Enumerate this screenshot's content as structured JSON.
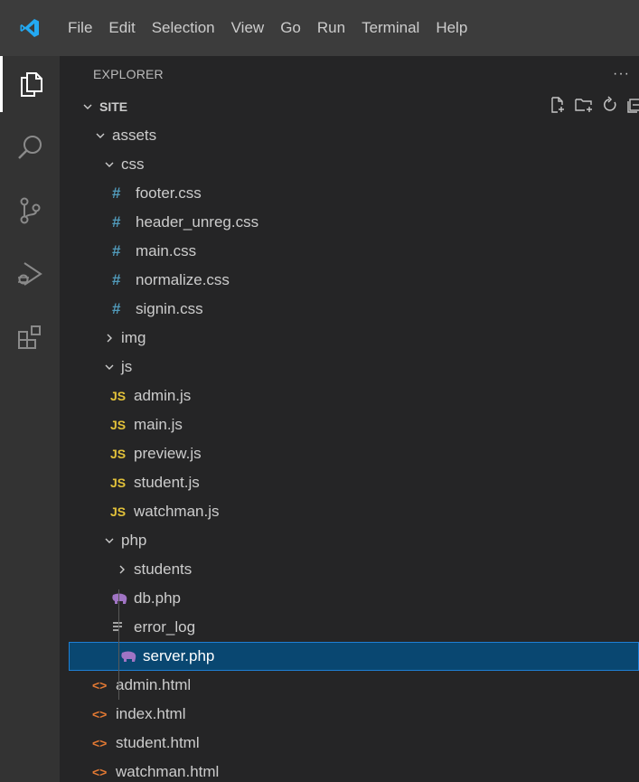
{
  "menu": [
    "File",
    "Edit",
    "Selection",
    "View",
    "Go",
    "Run",
    "Terminal",
    "Help"
  ],
  "explorer": {
    "title": "EXPLORER",
    "more": "···",
    "root": "SITE"
  },
  "tree": [
    {
      "label": "assets",
      "type": "folder",
      "open": true,
      "depth": 1
    },
    {
      "label": "css",
      "type": "folder",
      "open": true,
      "depth": 2
    },
    {
      "label": "footer.css",
      "type": "css",
      "depth": 3
    },
    {
      "label": "header_unreg.css",
      "type": "css",
      "depth": 3
    },
    {
      "label": "main.css",
      "type": "css",
      "depth": 3
    },
    {
      "label": "normalize.css",
      "type": "css",
      "depth": 3
    },
    {
      "label": "signin.css",
      "type": "css",
      "depth": 3
    },
    {
      "label": "img",
      "type": "folder",
      "open": false,
      "depth": 2
    },
    {
      "label": "js",
      "type": "folder",
      "open": true,
      "depth": 2
    },
    {
      "label": "admin.js",
      "type": "js",
      "depth": 3
    },
    {
      "label": "main.js",
      "type": "js",
      "depth": 3
    },
    {
      "label": "preview.js",
      "type": "js",
      "depth": 3
    },
    {
      "label": "student.js",
      "type": "js",
      "depth": 3
    },
    {
      "label": "watchman.js",
      "type": "js",
      "depth": 3
    },
    {
      "label": "php",
      "type": "folder",
      "open": true,
      "depth": 2
    },
    {
      "label": "students",
      "type": "folder",
      "open": false,
      "depth": 3
    },
    {
      "label": "db.php",
      "type": "php",
      "depth": 3
    },
    {
      "label": "error_log",
      "type": "log",
      "depth": 3
    },
    {
      "label": "server.php",
      "type": "php",
      "depth": 3,
      "selected": true
    },
    {
      "label": "admin.html",
      "type": "html",
      "depth": 1
    },
    {
      "label": "index.html",
      "type": "html",
      "depth": 1
    },
    {
      "label": "student.html",
      "type": "html",
      "depth": 1
    },
    {
      "label": "watchman.html",
      "type": "html",
      "depth": 1
    }
  ],
  "icons": {
    "css": "#",
    "js": "JS",
    "html": "<>"
  },
  "colors": {
    "titlebar": "#3c3c3c",
    "activitybar": "#333333",
    "sidebar": "#252526",
    "selection": "#094771",
    "css_icon": "#519aba",
    "js_icon": "#e3c23a",
    "html_icon": "#e37933",
    "php_icon": "#a074c4"
  }
}
